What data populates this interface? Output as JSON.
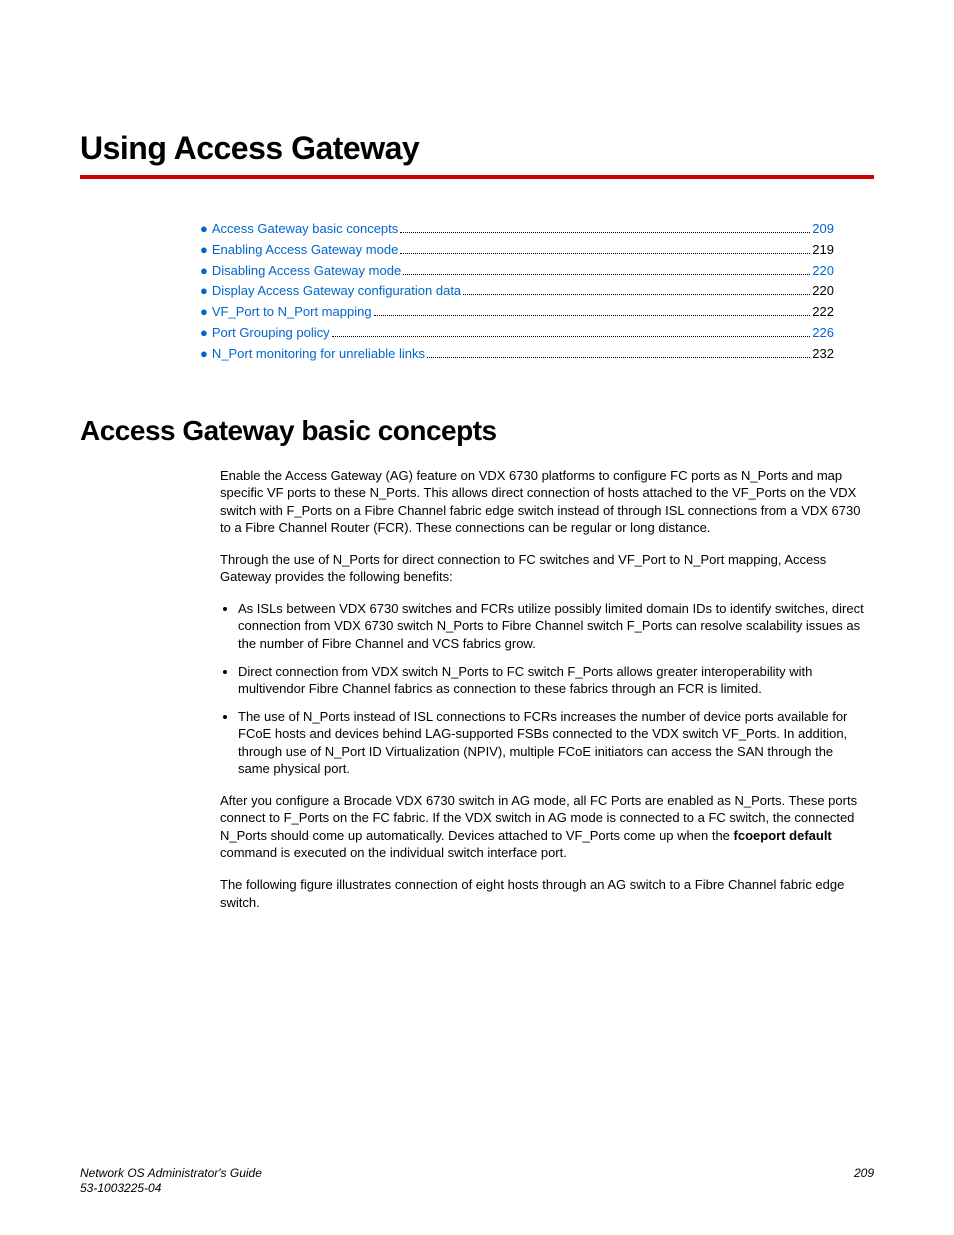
{
  "chapter_title": "Using Access Gateway",
  "toc": [
    {
      "label": "Access Gateway basic concepts",
      "page": "209",
      "blue_page": true
    },
    {
      "label": "Enabling Access Gateway mode",
      "page": "219",
      "blue_page": false
    },
    {
      "label": "Disabling Access Gateway mode",
      "page": "220",
      "blue_page": true
    },
    {
      "label": "Display Access Gateway configuration data",
      "page": "220",
      "blue_page": false
    },
    {
      "label": "VF_Port to N_Port mapping",
      "page": "222",
      "blue_page": false
    },
    {
      "label": "Port Grouping policy",
      "page": "226",
      "blue_page": true
    },
    {
      "label": "N_Port monitoring for unreliable links",
      "page": "232",
      "blue_page": false
    }
  ],
  "section_title": "Access Gateway basic concepts",
  "para1": "Enable the Access Gateway (AG) feature on VDX 6730 platforms to configure FC ports as N_Ports and map specific VF ports to these N_Ports. This allows direct connection of hosts attached to the VF_Ports on the VDX switch with F_Ports on a Fibre Channel fabric edge switch instead of through ISL connections from a VDX 6730 to a Fibre Channel Router (FCR). These connections can be regular or long distance.",
  "para2": "Through the use of N_Ports for direct connection to FC switches and VF_Port to N_Port mapping, Access Gateway provides the following benefits:",
  "bullets": [
    "As ISLs between VDX 6730 switches and FCRs utilize possibly limited domain IDs to identify switches, direct connection from VDX 6730 switch N_Ports to Fibre Channel switch F_Ports can resolve scalability issues as the number of Fibre Channel and VCS fabrics grow.",
    "Direct connection from VDX switch N_Ports to FC switch F_Ports allows greater interoperability with multivendor Fibre Channel fabrics as connection to these fabrics through an FCR is limited.",
    "The use of N_Ports instead of ISL connections to FCRs increases the number of device ports available for FCoE hosts and devices behind LAG-supported FSBs connected to the VDX switch VF_Ports. In addition, through use of N_Port ID Virtualization (NPIV), multiple FCoE initiators can access the SAN through the same physical port."
  ],
  "para3_a": "After you configure a Brocade VDX 6730 switch in AG mode, all FC Ports are enabled as N_Ports. These ports connect to F_Ports on the FC fabric. If the VDX switch in AG mode is connected to a FC switch, the connected N_Ports should come up automatically. Devices attached to VF_Ports come up when the ",
  "para3_bold": "fcoeport default",
  "para3_b": " command is executed on the individual switch interface port.",
  "para4": "The following figure illustrates connection of eight hosts through an AG switch to a Fibre Channel fabric edge switch.",
  "footer": {
    "title": "Network OS Administrator's Guide",
    "docnum": "53-1003225-04",
    "page": "209"
  }
}
